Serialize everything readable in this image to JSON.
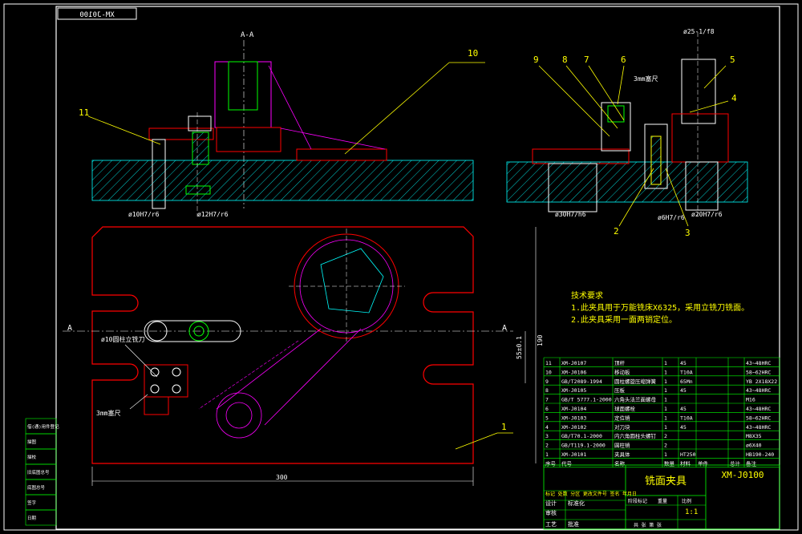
{
  "drawing": {
    "mirrored_code": "XM-J0100",
    "section_label": "A-A",
    "section_marker": "A",
    "part_numbers": [
      "1",
      "2",
      "3",
      "4",
      "5",
      "6",
      "7",
      "8",
      "9",
      "10",
      "11"
    ],
    "dimensions": {
      "phi10": "ø10H7/r6",
      "phi12": "ø12H7/r6",
      "phi30": "ø30H7/h6",
      "phi6": "ø6H7/r6",
      "phi20": "ø20H7/r6",
      "phi25": "ø25-1/f8",
      "h_55": "55±0.1",
      "h_190": "190",
      "w_300": "300"
    },
    "notes": {
      "cutter_left": "ø10圆柱立铣刀",
      "feeler_left": "3mm塞尺",
      "feeler_right": "3mm塞尺"
    },
    "tech_requirements": {
      "heading": "技术要求",
      "line1": "1.此夹具用于万能铣床X6325，采用立铣刀铣面。",
      "line2": "2.此夹具采用一面两销定位。"
    },
    "parts_table": {
      "rows": [
        {
          "no": "11",
          "code": "XM-J0107",
          "name": "顶杆",
          "qty": "1",
          "mat": "45",
          "note": "43~48HRC"
        },
        {
          "no": "10",
          "code": "XM-J0106",
          "name": "移动板",
          "qty": "1",
          "mat": "T10A",
          "note": "58~62HRC"
        },
        {
          "no": "9",
          "code": "GB/T2089-1994",
          "name": "圆柱螺旋压缩弹簧",
          "qty": "1",
          "mat": "65Mn",
          "note": "YB 2X18X22"
        },
        {
          "no": "8",
          "code": "XM-J0105",
          "name": "压板",
          "qty": "1",
          "mat": "45",
          "note": "43~48HRC"
        },
        {
          "no": "7",
          "code": "GB/T 5777.1-2000",
          "name": "六角头法兰面螺母",
          "qty": "1",
          "mat": "",
          "note": "M16"
        },
        {
          "no": "6",
          "code": "XM-J0104",
          "name": "球面螺栓",
          "qty": "1",
          "mat": "45",
          "note": "43~48HRC"
        },
        {
          "no": "5",
          "code": "XM-J0103",
          "name": "定位销",
          "qty": "1",
          "mat": "T10A",
          "note": "58~62HRC"
        },
        {
          "no": "4",
          "code": "XM-J0102",
          "name": "对刀块",
          "qty": "1",
          "mat": "45",
          "note": "43~48HRC"
        },
        {
          "no": "3",
          "code": "GB/T70.1-2000",
          "name": "内六角圆柱头螺钉",
          "qty": "2",
          "mat": "",
          "note": "M8X35"
        },
        {
          "no": "2",
          "code": "GB/T119.1-2000",
          "name": "圆柱销",
          "qty": "2",
          "mat": "",
          "note": "ø6X40"
        },
        {
          "no": "1",
          "code": "XM-J0101",
          "name": "夹具体",
          "qty": "1",
          "mat": "HT250",
          "note": "HB190-240"
        }
      ],
      "header": [
        "序号",
        "代号",
        "名称",
        "数量",
        "材料",
        "单件",
        "总计",
        "备注"
      ]
    },
    "title_block": {
      "title": "铣面夹具",
      "code": "XM-J0100",
      "scale": "1:1",
      "designer": "设计",
      "checker": "校核",
      "review": "审核",
      "craft": "工艺",
      "standard": "标准化",
      "approve": "批准",
      "mark": "阶段标记",
      "weight": "重量",
      "ratio": "比例",
      "sheet": "共 张 第 张",
      "change": "标记 处数 分区 更改文件号 签名 年月日"
    },
    "side_stamp": [
      "借(通)用件登记",
      "描图",
      "描校",
      "旧底图总号",
      "底图总号",
      "签字",
      "日期"
    ]
  },
  "colors": {
    "frame": "#ffffff",
    "part": "#ff0000",
    "hatch": "#00ffff",
    "center": "#ff00ff",
    "leader": "#ffff00",
    "green": "#00ff00",
    "dim": "#ffffff"
  }
}
